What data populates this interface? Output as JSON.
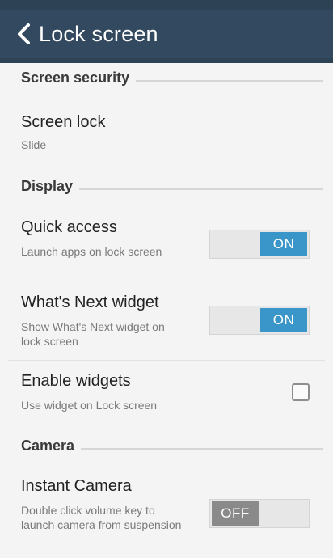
{
  "header": {
    "title": "Lock screen",
    "back_icon": "chevron-left-icon"
  },
  "sections": {
    "screen_security": {
      "label": "Screen security"
    },
    "display": {
      "label": "Display"
    },
    "camera": {
      "label": "Camera"
    }
  },
  "items": {
    "screen_lock": {
      "title": "Screen lock",
      "summary": "Slide"
    },
    "quick_access": {
      "title": "Quick access",
      "summary": "Launch apps on lock screen",
      "toggle": "ON",
      "enabled": true
    },
    "whats_next": {
      "title": "What's Next widget",
      "summary": "Show What's Next widget on lock screen",
      "toggle": "ON",
      "enabled": true
    },
    "enable_widgets": {
      "title": "Enable widgets",
      "summary": "Use widget on Lock screen",
      "checked": false
    },
    "instant_camera": {
      "title": "Instant Camera",
      "summary": "Double click volume key to launch camera from suspension",
      "toggle": "OFF",
      "enabled": false
    }
  },
  "colors": {
    "header": "#33495f",
    "switch_on": "#3a95c9",
    "switch_off": "#8a8a8a",
    "background": "#f4f4f4"
  }
}
